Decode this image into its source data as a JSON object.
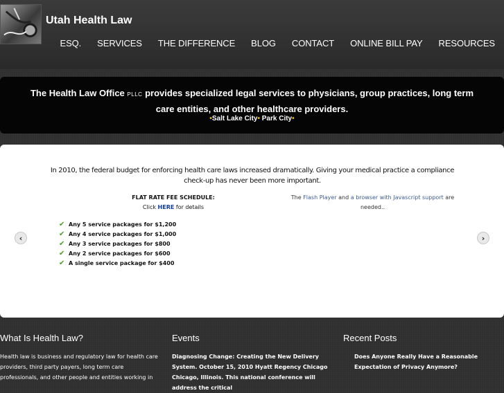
{
  "site": {
    "title": "Utah Health Law"
  },
  "nav": [
    "ESQ.",
    "SERVICES",
    "THE DIFFERENCE",
    "BLOG",
    "CONTACT",
    "ONLINE BILL PAY",
    "RESOURCES"
  ],
  "banner": {
    "office": "The Health Law Office",
    "pllc": "PLLC",
    "tagline": "provides specialized legal services to physicians, group practices, long term care entities, and other healthcare providers.",
    "city1": "Salt Lake City",
    "city2": "Park City",
    "bullet": "•"
  },
  "slider": {
    "intro": "In 2010, the federal budget for enforcing health care laws increased dramatically. Giving your medical practice a compliance check-up has never been more important.",
    "fee_title": "FLAT RATE FEE SCHEDULE:",
    "fee_click": "Click",
    "fee_here": "HERE",
    "fee_details": "for details",
    "flash_the": "The",
    "flash_player": "Flash Player",
    "flash_and": "and",
    "flash_browser": "a browser with Javascript support",
    "flash_needed": "are needed..",
    "packages": [
      "Any 5 service packages for $1,200",
      "Any 4 service packages for $1,000",
      "Any 3 service packages for $800",
      "Any 2 service packages for $600",
      "A single service package for $400"
    ],
    "prev": "‹",
    "next": "›"
  },
  "columns": {
    "what": {
      "heading": "What Is Health Law?",
      "text": "Health law is business and regulatory law for health care providers, third party payers, long term care professionals, and other people and entities working in"
    },
    "events": {
      "heading": "Events",
      "text": "Diagnosing Change: Creating the New Delivery System. October 15, 2010 Hyatt Regency Chicago Chicago, Illinois. This national conference will address the critical"
    },
    "recent": {
      "heading": "Recent Posts",
      "post1": "Does Anyone Really Have a Reasonable Expectation of Privacy Anymore?"
    }
  },
  "colors": {
    "banner_bg": "#050505",
    "accent_dot": "#e8c000",
    "link": "#0b3bb5",
    "check": "#4a9d2a"
  }
}
